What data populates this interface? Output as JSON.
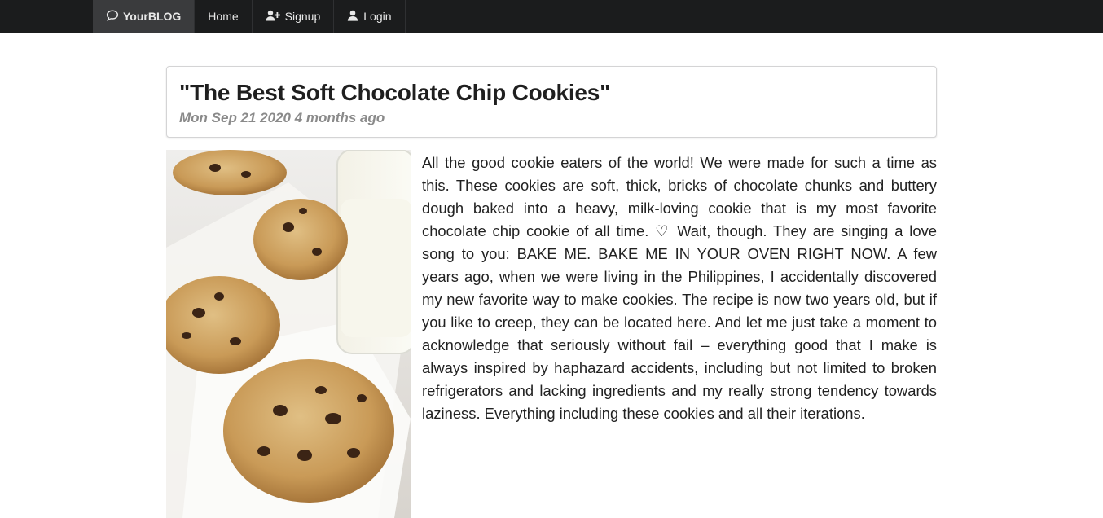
{
  "nav": {
    "brand": "YourBLOG",
    "items": [
      {
        "label": "Home",
        "icon": "none"
      },
      {
        "label": "Signup",
        "icon": "user-plus-icon"
      },
      {
        "label": "Login",
        "icon": "user-icon"
      }
    ]
  },
  "post": {
    "title": "\"The Best Soft Chocolate Chip Cookies\"",
    "date": "Mon Sep 21 2020",
    "relative": "4 months ago",
    "image_alt": "chocolate chip cookies with a jar of milk",
    "body": "All the good cookie eaters of the world! We were made for such a time as this. These cookies are soft, thick, bricks of chocolate chunks and buttery dough baked into a heavy, milk-loving cookie that is my most favorite chocolate chip cookie of all time. ♡ Wait, though. They are singing a love song to you: BAKE ME. BAKE ME IN YOUR OVEN RIGHT NOW. A few years ago, when we were living in the Philippines, I accidentally discovered my new favorite way to make cookies. The recipe is now two years old, but if you like to creep, they can be located here. And let me just take a moment to acknowledge that seriously without fail – everything good that I make is always inspired by haphazard accidents, including but not limited to broken refrigerators and lacking ingredients and my really strong tendency towards laziness. Everything including these cookies and all their iterations."
  },
  "colors": {
    "navbar": "#1b1c1d",
    "brand_bg": "#3a3b3d",
    "meta": "#8a8a8a"
  }
}
